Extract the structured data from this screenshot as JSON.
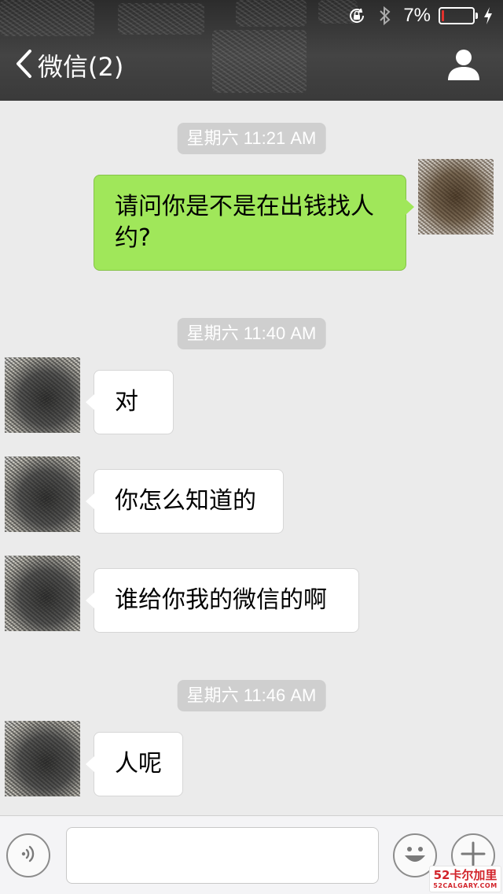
{
  "status_bar": {
    "battery_percent_label": "7%",
    "battery_level": 0.07,
    "icons": [
      "orientation-lock-icon",
      "bluetooth-icon",
      "battery-icon",
      "charging-bolt-icon"
    ],
    "battery_color": "#e3322d"
  },
  "nav": {
    "back_label": "微信(2)",
    "back_icon": "chevron-left-icon",
    "profile_icon": "person-icon"
  },
  "chat": {
    "timestamps": [
      "星期六 11:21 AM",
      "星期六 11:40 AM",
      "星期六 11:46 AM"
    ],
    "messages": [
      {
        "sender": "me",
        "text": "请问你是不是在出钱找人约?"
      },
      {
        "sender": "other",
        "text": "对"
      },
      {
        "sender": "other",
        "text": "你怎么知道的"
      },
      {
        "sender": "other",
        "text": "谁给你我的微信的啊"
      },
      {
        "sender": "other",
        "text": "人呢"
      }
    ],
    "colors": {
      "outgoing_bubble": "#a0e75a",
      "incoming_bubble": "#ffffff",
      "background": "#ebebeb"
    }
  },
  "input_bar": {
    "voice_icon": "voice-icon",
    "emoji_icon": "smiley-icon",
    "more_icon": "plus-icon",
    "text_value": ""
  },
  "watermark": {
    "main": "52卡尔加里",
    "sub": "52CALGARY.COM"
  }
}
